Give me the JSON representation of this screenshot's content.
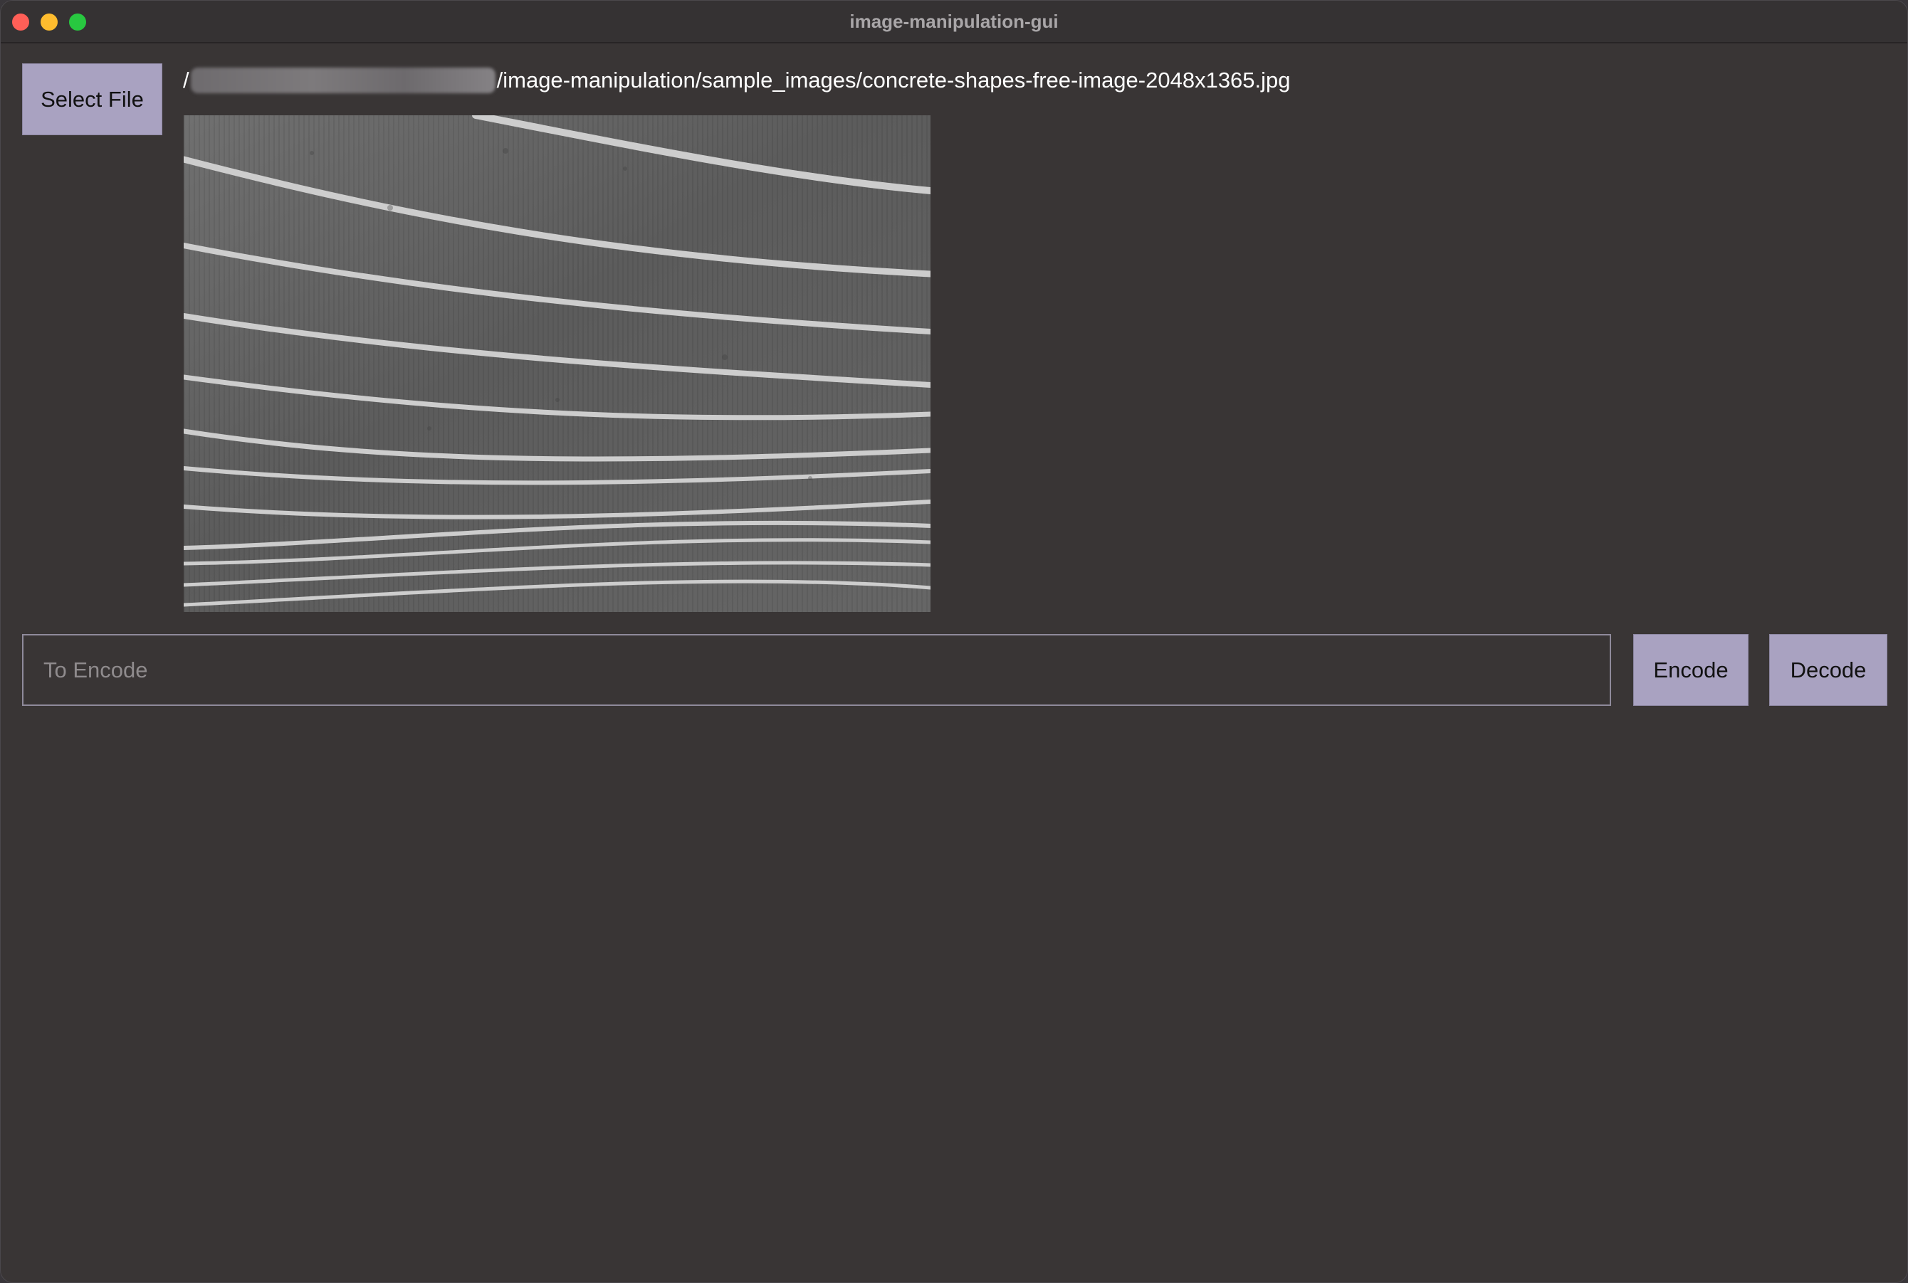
{
  "window": {
    "title": "image-manipulation-gui"
  },
  "file": {
    "select_label": "Select File",
    "path_prefix": "/",
    "path_suffix": "/image-manipulation/sample_images/concrete-shapes-free-image-2048x1365.jpg"
  },
  "encoder": {
    "placeholder": "To Encode",
    "value": "",
    "encode_label": "Encode",
    "decode_label": "Decode"
  },
  "colors": {
    "background": "#393535",
    "button": "#a9a2c1",
    "titlebar": "#353233"
  }
}
